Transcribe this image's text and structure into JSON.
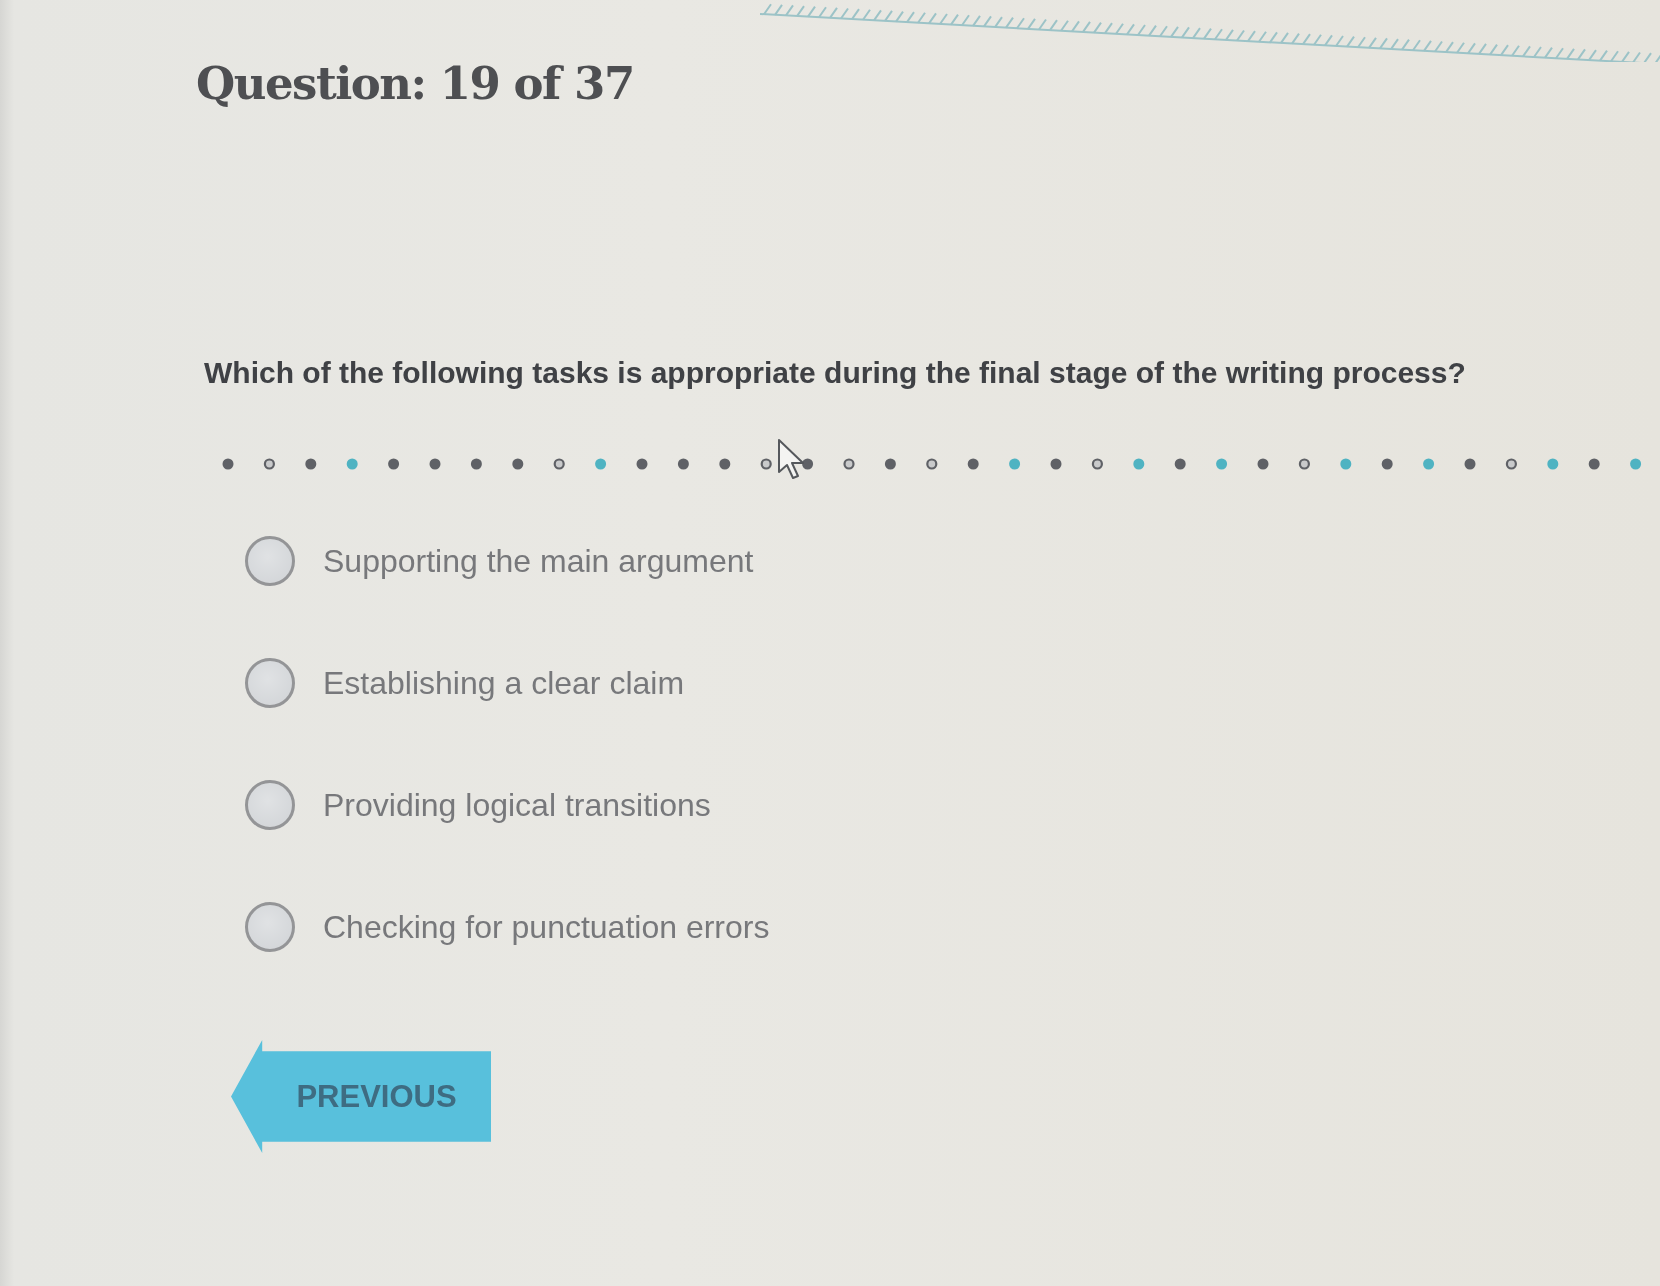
{
  "header": {
    "title": "Question: 19 of 37"
  },
  "question": {
    "prompt": "Which of the following tasks is appropriate during the final stage of the writing process?"
  },
  "options": [
    {
      "label": "Supporting the main argument",
      "selected": false
    },
    {
      "label": "Establishing a clear claim",
      "selected": false
    },
    {
      "label": "Providing logical transitions",
      "selected": false
    },
    {
      "label": "Checking for punctuation errors",
      "selected": false
    }
  ],
  "navigation": {
    "previous_button": "PREVIOUS"
  }
}
